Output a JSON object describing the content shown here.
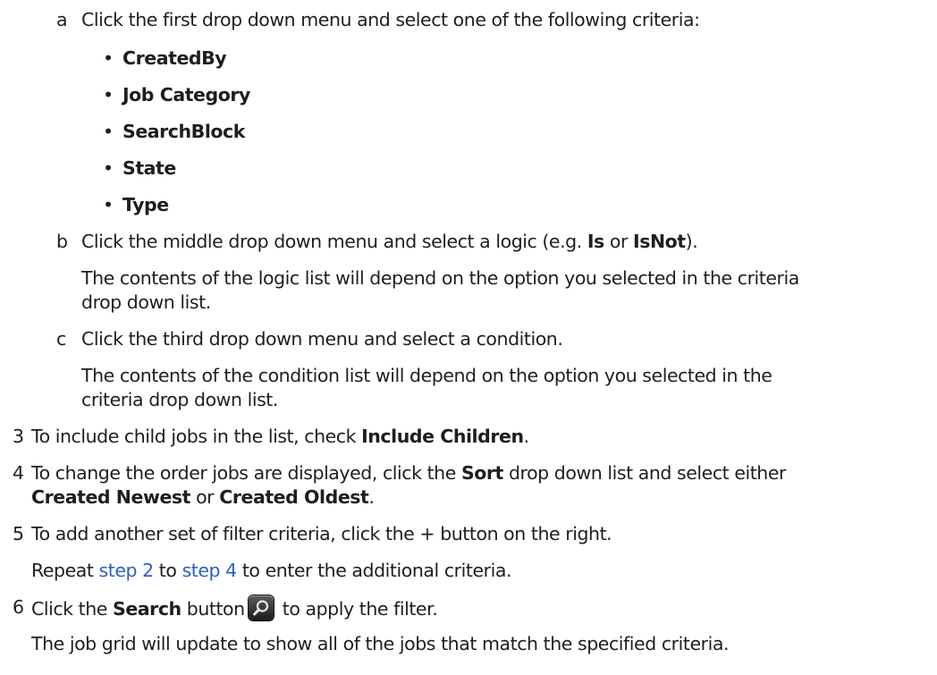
{
  "steps": {
    "a": {
      "marker": "a",
      "text": "Click the first drop down menu and select one of the following criteria:",
      "criteria": [
        "CreatedBy",
        "Job Category",
        "SearchBlock",
        "State",
        "Type"
      ]
    },
    "b": {
      "marker": "b",
      "pre": "Click the middle drop down menu and select a logic (e.g. ",
      "bold1": "Is",
      "mid": " or ",
      "bold2": "IsNot",
      "post": ").",
      "note_line1": "The contents of the logic list will depend on the option you selected in the criteria",
      "note_line2": "drop down list."
    },
    "c": {
      "marker": "c",
      "text": "Click the third drop down menu and select a condition.",
      "note_line1": "The contents of the condition list will depend on the option you selected in the",
      "note_line2": "criteria drop down list."
    },
    "s3": {
      "number": "3",
      "pre": "To include child jobs in the list, check ",
      "bold": "Include Children",
      "post": "."
    },
    "s4": {
      "number": "4",
      "pre": "To change the order jobs are displayed, click the ",
      "bold1": "Sort",
      "post1": " drop down list and select either",
      "bold2": "Created Newest",
      "mid": " or ",
      "bold3": "Created Oldest",
      "post2": "."
    },
    "s5": {
      "number": "5",
      "text": "To add another set of filter criteria, click the + button on the right.",
      "repeat_pre": "Repeat ",
      "link1": "step 2",
      "repeat_mid": " to ",
      "link2": "step 4",
      "repeat_post": " to enter the additional criteria."
    },
    "s6": {
      "number": "6",
      "pre": "Click the ",
      "bold": "Search",
      "mid": " button",
      "post": " to apply the filter.",
      "icon": "search-magnifier-icon",
      "result": "The job grid will update to show all of the jobs that match the specified criteria."
    }
  },
  "colors": {
    "text": "#1e1e1e",
    "link": "#2d5fc0",
    "button": "#2a2a2a"
  }
}
